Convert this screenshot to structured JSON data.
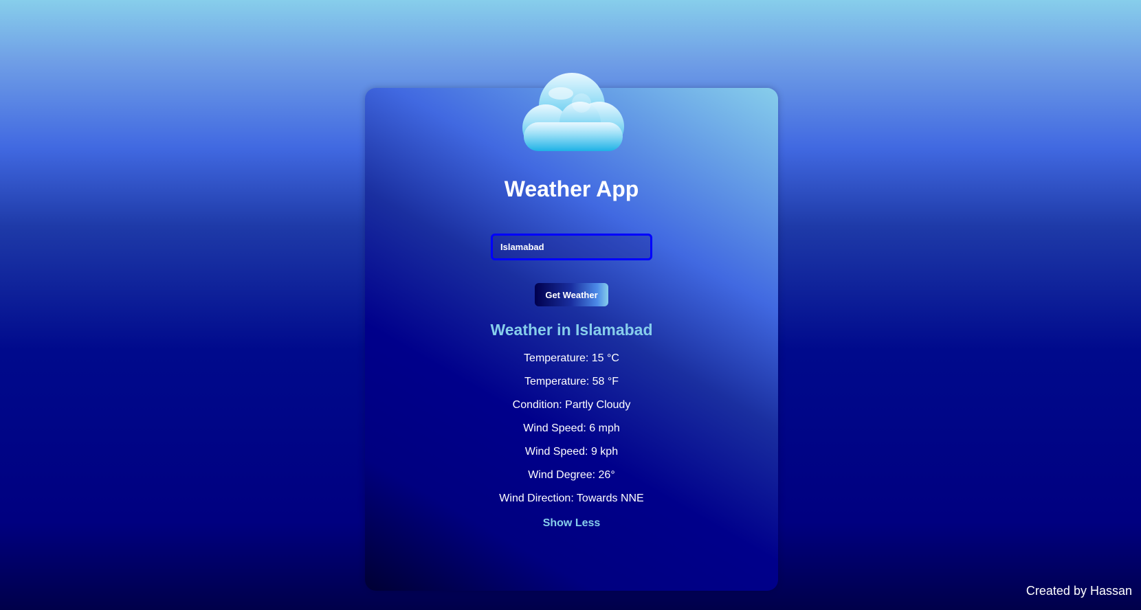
{
  "app": {
    "title": "Weather App",
    "icon": "moon-cloud-icon"
  },
  "search": {
    "value": "Islamabad",
    "button_label": "Get Weather"
  },
  "result": {
    "heading": "Weather in Islamabad",
    "details": [
      "Temperature: 15 °C",
      "Temperature: 58 °F",
      "Condition: Partly Cloudy",
      "Wind Speed: 6 mph",
      "Wind Speed: 9 kph",
      "Wind Degree: 26°",
      "Wind Direction: Towards NNE"
    ],
    "toggle_label": "Show Less"
  },
  "footer": {
    "credit": "Created by Hassan"
  },
  "colors": {
    "accent": "#87ceeb",
    "input_border": "#0000ff",
    "royal_blue": "#4169e1",
    "navy": "#000080"
  }
}
